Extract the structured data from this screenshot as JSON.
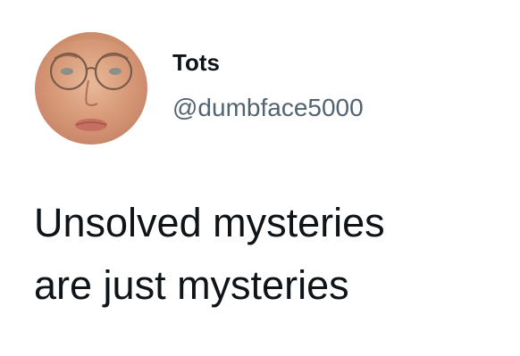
{
  "tweet": {
    "author": {
      "display_name": "Tots",
      "handle": "@dumbface5000",
      "avatar_icon": "profile-photo"
    },
    "text_lines": [
      "Unsolved mysteries",
      "are just mysteries"
    ]
  },
  "colors": {
    "name": "#0f1419",
    "handle": "#536471",
    "background": "#ffffff"
  }
}
